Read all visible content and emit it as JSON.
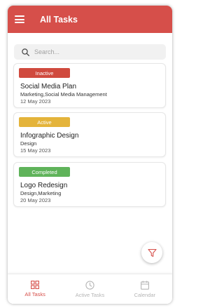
{
  "header": {
    "title": "All Tasks"
  },
  "search": {
    "placeholder": "Search..."
  },
  "tasks": [
    {
      "status": "Inactive",
      "status_color": "#d04a3e",
      "title": "Social Media Plan",
      "tags": "Marketing,Social Media Management",
      "date": "12 May 2023"
    },
    {
      "status": "Active",
      "status_color": "#e4b43b",
      "title": "Infographic Design",
      "tags": "Design",
      "date": "15 May 2023"
    },
    {
      "status": "Completed",
      "status_color": "#5fb35a",
      "title": "Logo Redesign",
      "tags": "Design,Marketing",
      "date": "20 May 2023"
    }
  ],
  "fab": {
    "icon": "filter-icon"
  },
  "bottom_nav": [
    {
      "label": "All Tasks",
      "icon": "grid-icon",
      "active": true
    },
    {
      "label": "Active Tasks",
      "icon": "clock-icon",
      "active": false
    },
    {
      "label": "Calendar",
      "icon": "calendar-icon",
      "active": false
    }
  ],
  "colors": {
    "accent": "#d64f4a",
    "inactive_nav": "#b5b5b5"
  }
}
